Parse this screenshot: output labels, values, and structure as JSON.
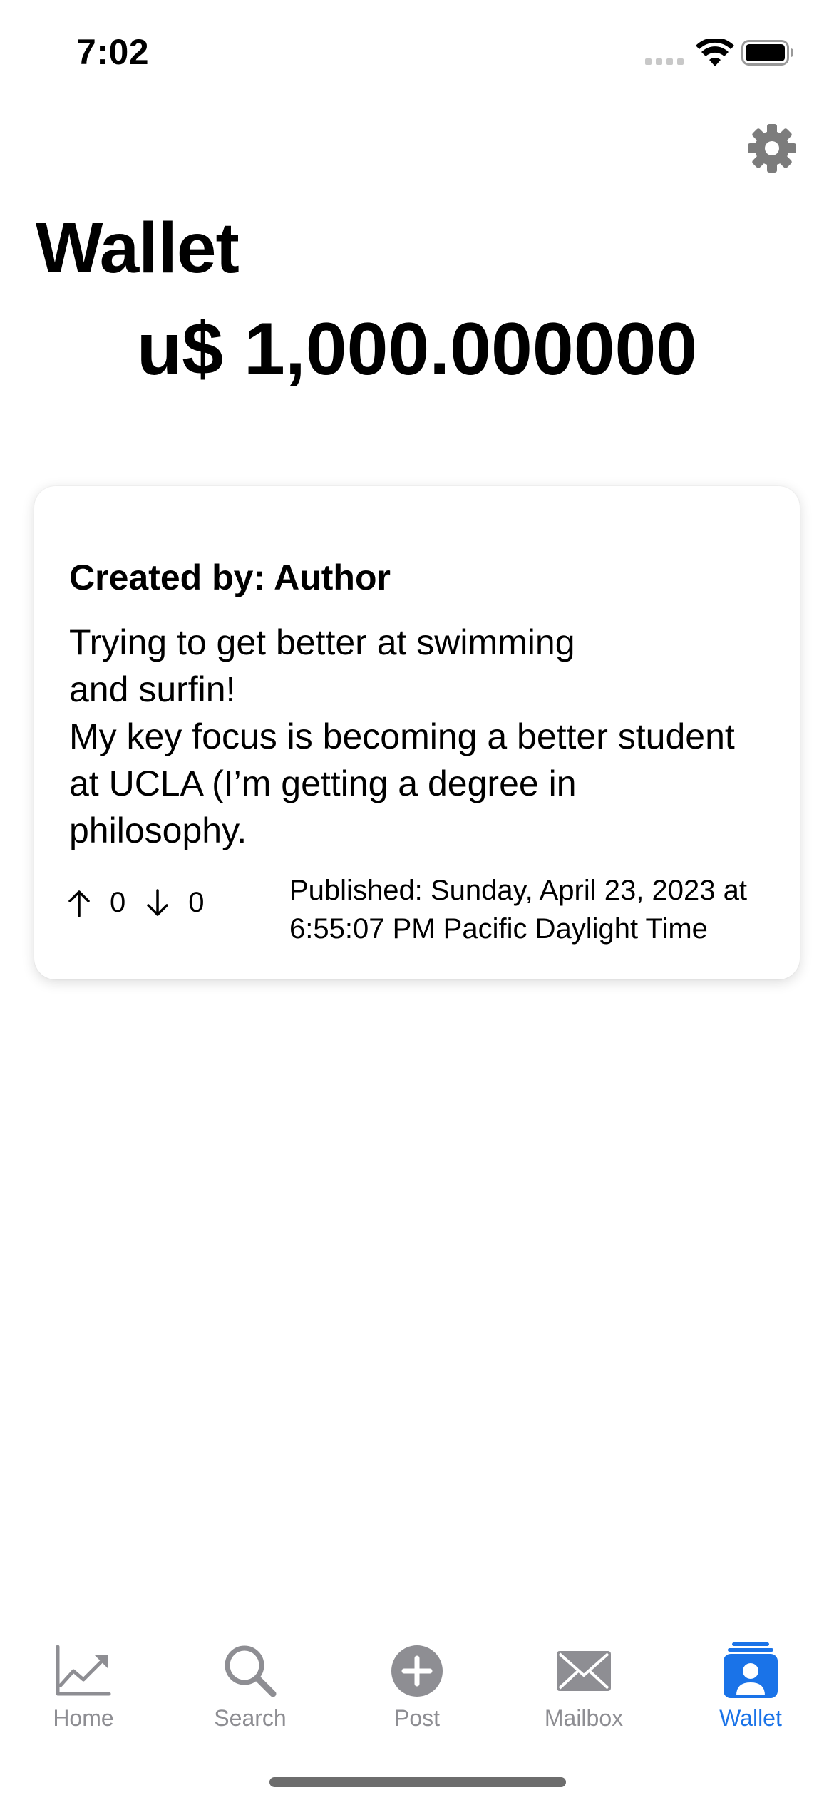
{
  "status_bar": {
    "time": "7:02"
  },
  "header": {
    "title": "Wallet",
    "balance": "u$ 1,000.000000",
    "settings_icon": "gear-icon"
  },
  "post": {
    "author_line": "Created by: Author",
    "body_lines": [
      "Trying to get better at swimming",
      "and surfin!",
      "My key focus is becoming a better student",
      "at UCLA (I’m getting a degree in",
      "philosophy."
    ],
    "upvotes": "0",
    "downvotes": "0",
    "published_lines": [
      "Published: Sunday, April 23, 2023 at",
      "6:55:07 PM Pacific Daylight Time"
    ]
  },
  "tab_bar": {
    "tabs": [
      {
        "label": "Home",
        "icon": "chart-line-icon",
        "active": false
      },
      {
        "label": "Search",
        "icon": "magnifier-icon",
        "active": false
      },
      {
        "label": "Post",
        "icon": "plus-circle-icon",
        "active": false
      },
      {
        "label": "Mailbox",
        "icon": "envelope-icon",
        "active": false
      },
      {
        "label": "Wallet",
        "icon": "wallet-person-icon",
        "active": true
      }
    ]
  },
  "colors": {
    "accent": "#1a73e8",
    "inactive": "#8e8e93",
    "icon_gray": "#7c7c7c"
  }
}
